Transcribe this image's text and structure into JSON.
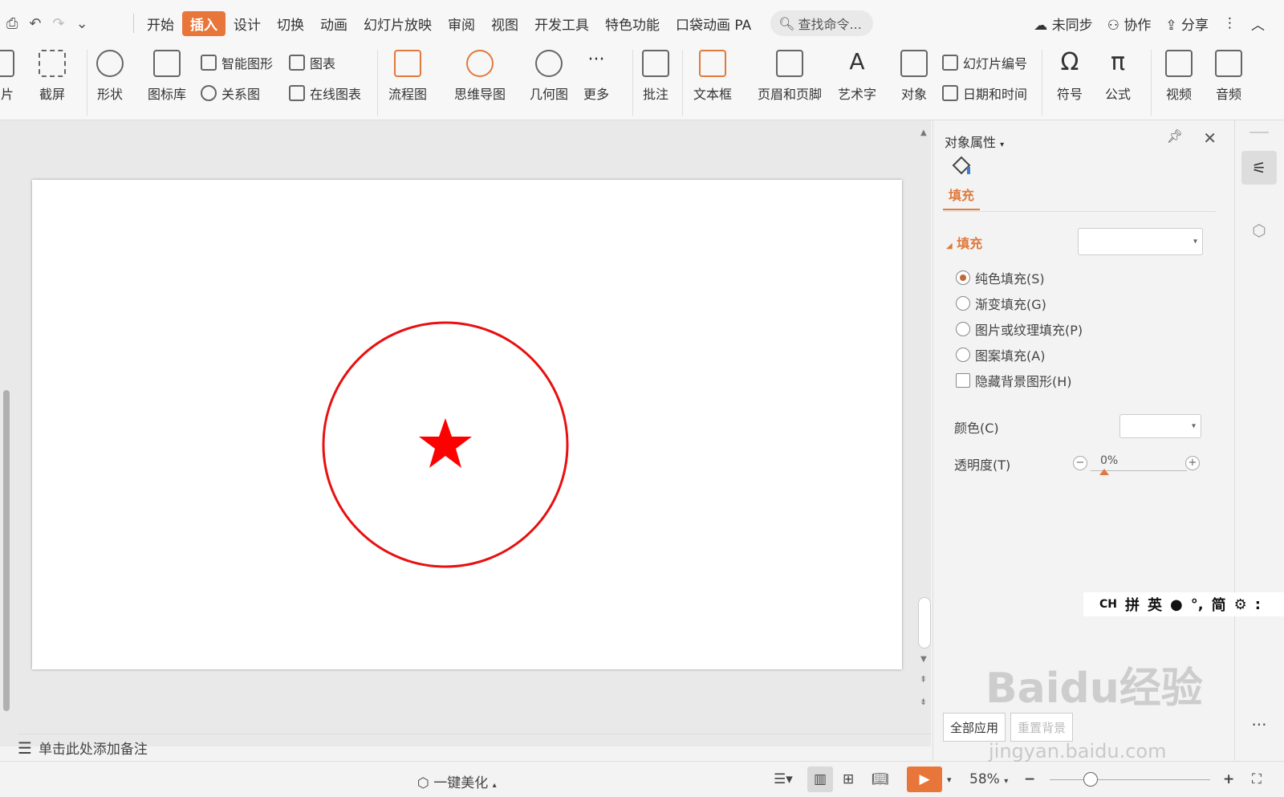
{
  "menubar": {
    "tabs": [
      "开始",
      "插入",
      "设计",
      "切换",
      "动画",
      "幻灯片放映",
      "审阅",
      "视图",
      "开发工具",
      "特色功能",
      "口袋动画 PA"
    ],
    "active_tab": "插入",
    "search_placeholder": "查找命令...",
    "sync": "未同步",
    "collab": "协作",
    "share": "分享"
  },
  "ribbon": {
    "picture": "图片",
    "screenshot": "截屏",
    "shape": "形状",
    "iconlib": "图标库",
    "smartart": "智能图形",
    "chart": "图表",
    "relation": "关系图",
    "onlinechart": "在线图表",
    "flow": "流程图",
    "mindmap": "思维导图",
    "geometry": "几何图",
    "more": "更多",
    "comment": "批注",
    "textbox": "文本框",
    "headerfooter": "页眉和页脚",
    "wordart": "艺术字",
    "object": "对象",
    "slidenum": "幻灯片编号",
    "datetime": "日期和时间",
    "symbol": "符号",
    "formula": "公式",
    "video": "视频",
    "audio": "音频"
  },
  "panel": {
    "title": "对象属性",
    "tab_fill": "填充",
    "section": "填充",
    "options": [
      "纯色填充(S)",
      "渐变填充(G)",
      "图片或纹理填充(P)",
      "图案填充(A)"
    ],
    "hide_bg": "隐藏背景图形(H)",
    "color_label": "颜色(C)",
    "transparency_label": "透明度(T)",
    "transparency": "0%",
    "apply_all": "全部应用",
    "reset_bg": "重置背景"
  },
  "notes": "单击此处添加备注",
  "status": {
    "beautify": "一键美化",
    "zoom": "58%"
  },
  "ime": [
    "CH",
    "拼",
    "英",
    "●",
    "°,",
    "简",
    "⚙",
    ":"
  ],
  "watermark": {
    "brand": "Baidu经验",
    "url": "jingyan.baidu.com"
  },
  "colors": {
    "accent": "#e8763a",
    "shape": "#e81010"
  }
}
